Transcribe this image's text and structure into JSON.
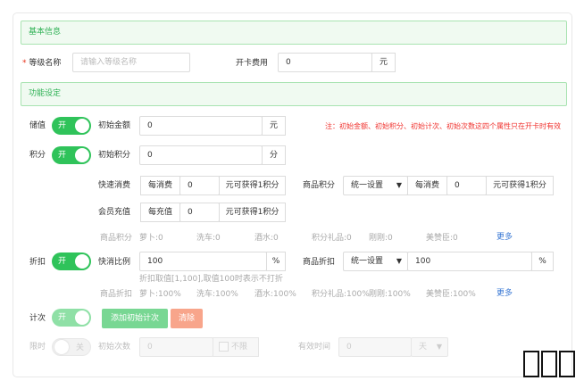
{
  "basic": {
    "header": "基本信息",
    "level_name_label": "等级名称",
    "required_mark": "*",
    "level_name_placeholder": "请输入等级名称",
    "fee_label": "开卡费用",
    "fee_value": "0",
    "fee_unit": "元"
  },
  "func": {
    "header": "功能设定",
    "stored_value": {
      "label": "储值",
      "toggle": "开",
      "initial_amount_label": "初始金额",
      "initial_amount_value": "0",
      "initial_amount_unit": "元",
      "note": "注：初始金额、初始积分、初始计次、初始次数这四个属性只在开卡时有效"
    },
    "points": {
      "label": "积分",
      "toggle": "开",
      "initial_points_label": "初始积分",
      "initial_points_value": "0",
      "initial_points_unit": "分",
      "fast_consume_label": "快速消费",
      "fast_consume_prefix": "每消费",
      "fast_consume_value": "0",
      "fast_consume_suffix": "元可获得1积分",
      "goods_points_label": "商品积分",
      "goods_points_select": "统一设置",
      "goods_points_prefix": "每消费",
      "goods_points_value": "0",
      "goods_points_suffix": "元可获得1积分",
      "recharge_label": "会员充值",
      "recharge_prefix": "每充值",
      "recharge_value": "0",
      "recharge_suffix": "元可获得1积分",
      "goods_list_label": "商品积分",
      "goods_list": [
        "萝卜:0",
        "洗车:0",
        "酒水:0",
        "积分礼品:0",
        "刚刚:0",
        "美赞臣:0"
      ],
      "more": "更多"
    },
    "discount": {
      "label": "折扣",
      "toggle": "开",
      "fast_ratio_label": "快消比例",
      "fast_ratio_value": "100",
      "fast_ratio_unit": "%",
      "hint": "折扣取值[1,100],取值100时表示不打折",
      "goods_discount_label": "商品折扣",
      "goods_discount_select": "统一设置",
      "goods_discount_value": "100",
      "goods_discount_unit": "%",
      "goods_list_label": "商品折扣",
      "goods_list": [
        "萝卜:100%",
        "洗车:100%",
        "酒水:100%",
        "积分礼品:100%",
        "刚刚:100%",
        "美赞臣:100%"
      ],
      "more": "更多"
    },
    "count": {
      "label": "计次",
      "toggle": "开",
      "add_button": "添加初始计次",
      "clear_button": "清除"
    },
    "timed": {
      "label": "限时",
      "toggle": "关",
      "initial_times_label": "初始次数",
      "initial_times_value": "0",
      "unlimited_label": "不限",
      "valid_time_label": "有效时间",
      "valid_time_value": "0",
      "valid_time_unit": "天"
    }
  },
  "colors": {
    "accent_green": "#2fc35a",
    "header_bg": "#f0faf1",
    "note_red": "#f0332f",
    "link_blue": "#3a78d4",
    "clear_orange": "#f8a58b"
  }
}
